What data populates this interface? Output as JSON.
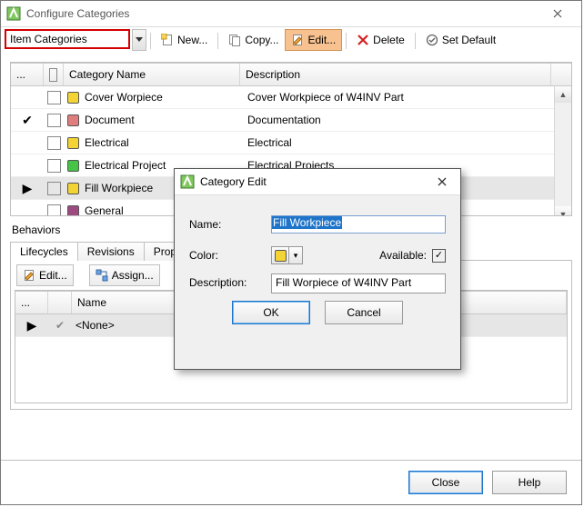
{
  "window": {
    "title": "Configure Categories",
    "close_btn": "×"
  },
  "toolbar": {
    "combo_value": "Item Categories",
    "new_label": "New...",
    "copy_label": "Copy...",
    "edit_label": "Edit...",
    "delete_label": "Delete",
    "setdefault_label": "Set Default"
  },
  "grid": {
    "headers": {
      "indicator": "...",
      "chk": "",
      "name": "Category Name",
      "desc": "Description"
    },
    "rows": [
      {
        "mark": "",
        "check": false,
        "color": "#f4d434",
        "name": "Cover Worpiece",
        "desc": "Cover Workpiece of W4INV Part"
      },
      {
        "mark": "✔",
        "check": false,
        "color": "#e07e7e",
        "name": "Document",
        "desc": "Documentation"
      },
      {
        "mark": "",
        "check": false,
        "color": "#f4d434",
        "name": "Electrical",
        "desc": "Electrical"
      },
      {
        "mark": "",
        "check": false,
        "color": "#45c445",
        "name": "Electrical Project",
        "desc": "Electrical Projects"
      },
      {
        "mark": "▶",
        "check": false,
        "color": "#f4d434",
        "name": "Fill Workpiece",
        "desc": "",
        "selected": true
      },
      {
        "mark": "",
        "check": false,
        "color": "#9c4a80",
        "name": "General",
        "desc": ""
      }
    ]
  },
  "behaviors": {
    "label": "Behaviors",
    "tabs": [
      "Lifecycles",
      "Revisions",
      "Propert"
    ],
    "toolbar": {
      "edit": "Edit...",
      "assign": "Assign..."
    },
    "grid": {
      "headers": {
        "indicator": "...",
        "name": "Name"
      },
      "rows": [
        {
          "mark": "▶",
          "check": "✔",
          "name": "<None>"
        }
      ]
    }
  },
  "footer": {
    "close": "Close",
    "help": "Help"
  },
  "modal": {
    "title": "Category Edit",
    "name_label": "Name:",
    "name_value": "Fill Workpiece",
    "color_label": "Color:",
    "available_label": "Available:",
    "available_checked": true,
    "desc_label": "Description:",
    "desc_value": "Fill Worpiece of W4INV Part",
    "ok": "OK",
    "cancel": "Cancel",
    "color_value": "#f4d434"
  }
}
